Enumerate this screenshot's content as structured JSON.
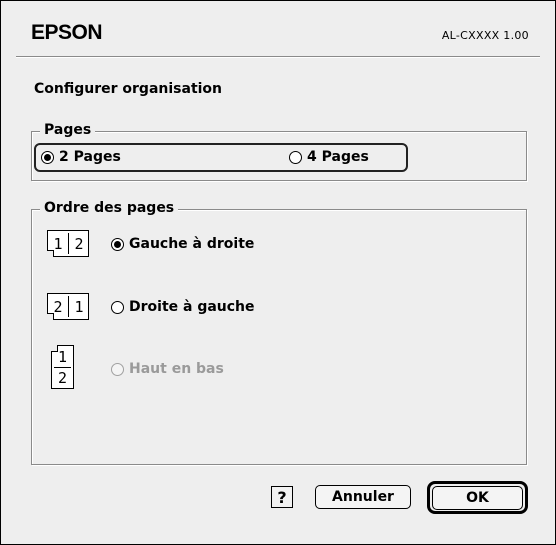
{
  "header": {
    "brand": "EPSON",
    "version": "AL-CXXXX 1.00"
  },
  "title": "Configurer organisation",
  "pages_group": {
    "label": "Pages",
    "options": [
      {
        "label": "2 Pages",
        "selected": true
      },
      {
        "label": "4 Pages",
        "selected": false
      }
    ]
  },
  "order_group": {
    "label": "Ordre des pages",
    "options": [
      {
        "label": "Gauche à droite",
        "selected": true,
        "enabled": true,
        "icon_cells": [
          "1",
          "2"
        ]
      },
      {
        "label": "Droite à gauche",
        "selected": false,
        "enabled": true,
        "icon_cells": [
          "2",
          "1"
        ]
      },
      {
        "label": "Haut en bas",
        "selected": false,
        "enabled": false,
        "icon_cells": [
          "1",
          "2"
        ]
      }
    ]
  },
  "footer": {
    "help_label": "?",
    "cancel_label": "Annuler",
    "ok_label": "OK"
  }
}
